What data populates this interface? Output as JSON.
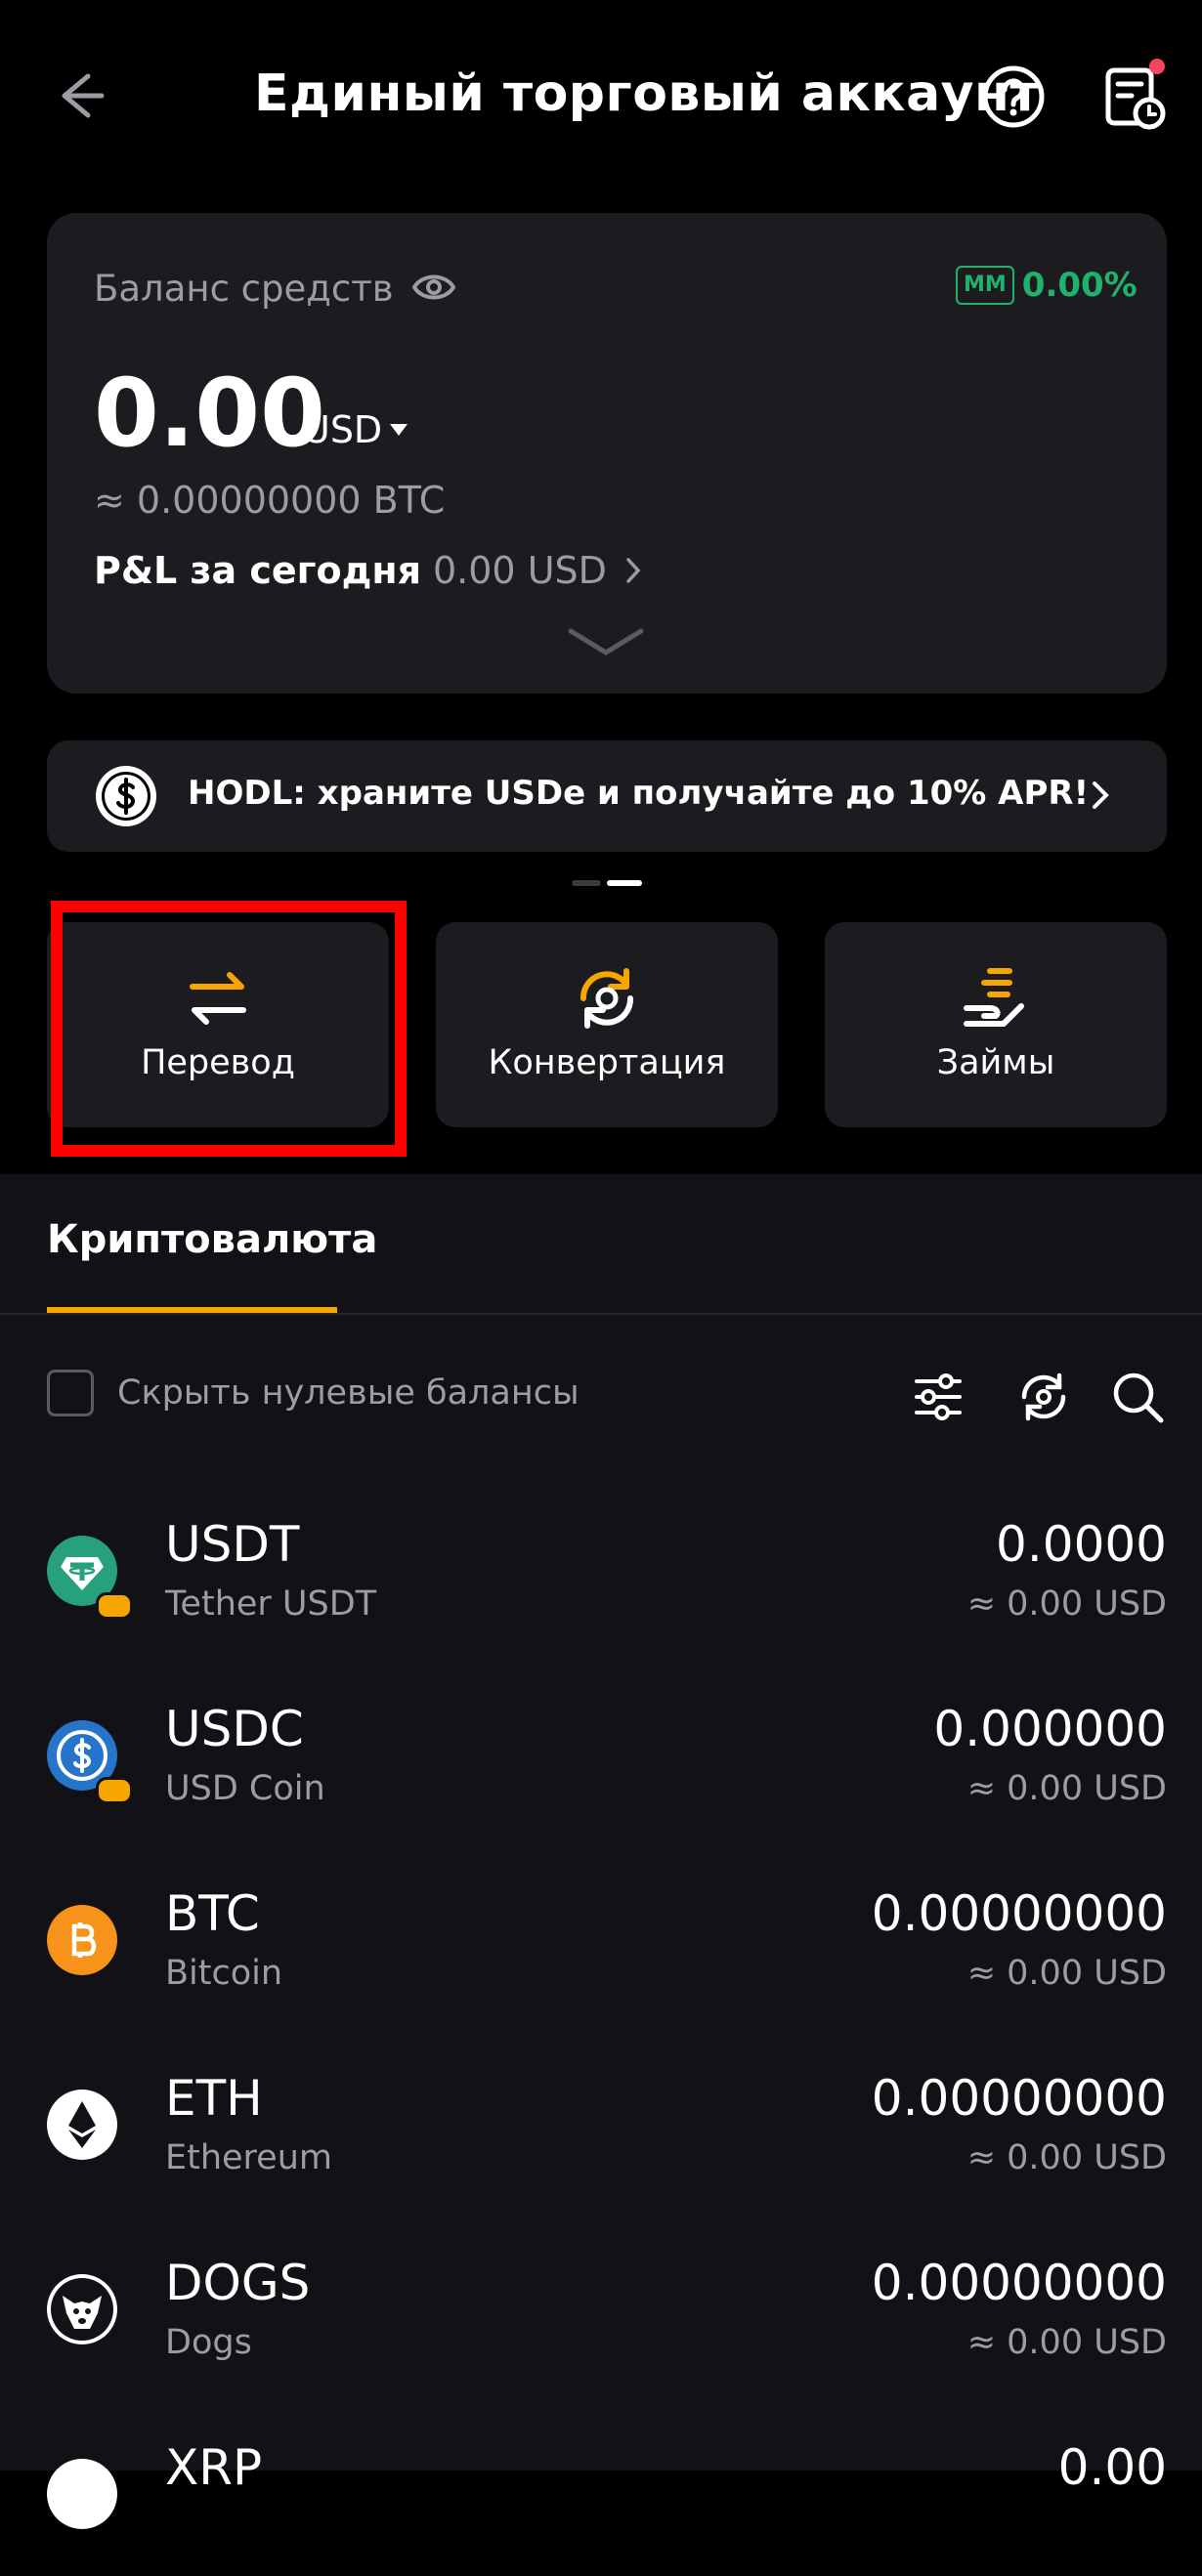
{
  "header": {
    "title": "Единый торговый аккаунт"
  },
  "balance": {
    "label": "Баланс средств",
    "mm_badge": "MM",
    "mm_value": "0.00%",
    "amount": "0.00",
    "currency": "USD",
    "btc_equiv": "≈ 0.00000000 BTC",
    "pnl_label": "P&L за сегодня",
    "pnl_value": "0.00 USD"
  },
  "promo": {
    "text": "HODL: храните USDe и получайте до 10% APR!"
  },
  "actions": [
    {
      "label": "Перевод"
    },
    {
      "label": "Конвертация"
    },
    {
      "label": "Займы"
    }
  ],
  "tabs": {
    "crypto": "Криптовалюта"
  },
  "filter": {
    "hide_zero_label": "Скрыть нулевые балансы"
  },
  "assets": [
    {
      "symbol": "USDT",
      "name": "Tether USDT",
      "amount": "0.0000",
      "usd": "≈ 0.00 USD"
    },
    {
      "symbol": "USDC",
      "name": "USD Coin",
      "amount": "0.000000",
      "usd": "≈ 0.00 USD"
    },
    {
      "symbol": "BTC",
      "name": "Bitcoin",
      "amount": "0.00000000",
      "usd": "≈ 0.00 USD"
    },
    {
      "symbol": "ETH",
      "name": "Ethereum",
      "amount": "0.00000000",
      "usd": "≈ 0.00 USD"
    },
    {
      "symbol": "DOGS",
      "name": "Dogs",
      "amount": "0.00000000",
      "usd": "≈ 0.00 USD"
    },
    {
      "symbol": "XRP",
      "name": "",
      "amount": "0.00",
      "usd": ""
    }
  ],
  "colors": {
    "accent": "#f7a600",
    "positive": "#20b26c",
    "card": "#1c1c20",
    "highlight": "#ff0000"
  }
}
